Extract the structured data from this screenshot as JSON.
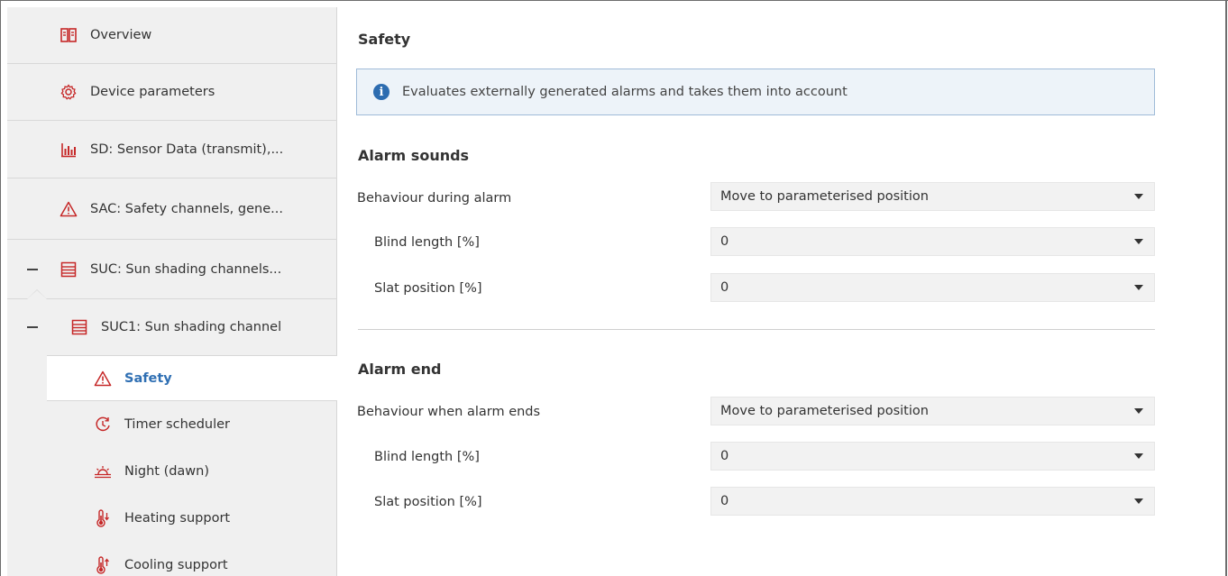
{
  "sidebar": {
    "items": [
      {
        "label": "Overview",
        "icon": "book-icon"
      },
      {
        "label": "Device parameters",
        "icon": "gear-icon"
      },
      {
        "label": "SD: Sensor Data (transmit),...",
        "icon": "bar-chart-icon"
      },
      {
        "label": "SAC: Safety channels, gene...",
        "icon": "warning-icon"
      },
      {
        "label": "SUC: Sun shading channels...",
        "icon": "blind-icon"
      },
      {
        "label": "SUC1:  Sun shading channel",
        "icon": "blind-icon"
      }
    ],
    "subitems": [
      {
        "label": "Safety",
        "icon": "warning-icon",
        "active": true
      },
      {
        "label": "Timer scheduler",
        "icon": "clock-icon"
      },
      {
        "label": "Night (dawn)",
        "icon": "dawn-icon"
      },
      {
        "label": "Heating support",
        "icon": "thermometer-heat-icon"
      },
      {
        "label": "Cooling support",
        "icon": "thermometer-cool-icon"
      }
    ]
  },
  "main": {
    "title": "Safety",
    "info_text": "Evaluates externally generated alarms and takes them into account",
    "alarm_sounds": {
      "heading": "Alarm sounds",
      "behaviour_label": "Behaviour during alarm",
      "behaviour_value": "Move to parameterised position",
      "blind_label": "Blind length [%]",
      "blind_value": "0",
      "slat_label": "Slat position [%]",
      "slat_value": "0"
    },
    "alarm_end": {
      "heading": "Alarm end",
      "behaviour_label": "Behaviour when alarm ends",
      "behaviour_value": "Move to parameterised position",
      "blind_label": "Blind length [%]",
      "blind_value": "0",
      "slat_label": "Slat position [%]",
      "slat_value": "0"
    }
  },
  "colors": {
    "accent": "#2f6fb3",
    "icon_red": "#c62828",
    "info_bg": "#edf3f9",
    "sidebar_bg": "#f0f0f0"
  }
}
